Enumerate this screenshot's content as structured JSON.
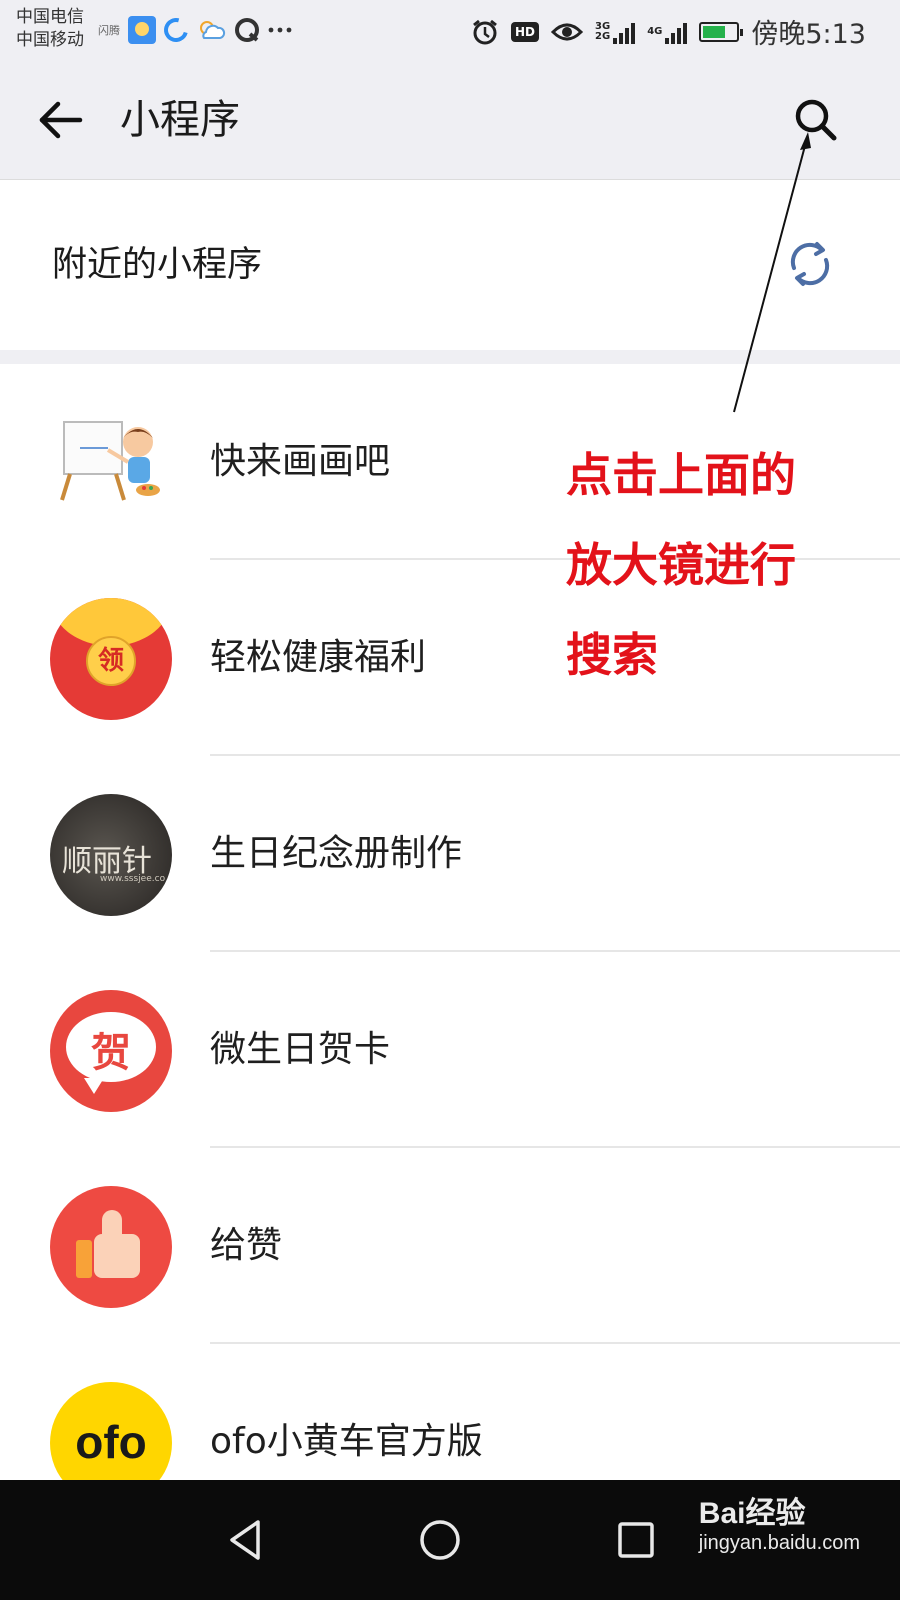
{
  "status_bar": {
    "carrier_1": "中国电信",
    "carrier_2": "中国移动",
    "small_label": "闪腾",
    "network_1": "3G",
    "network_2": "2G",
    "network_3": "4G",
    "hd": "HD",
    "time": "傍晚5:13",
    "battery_level": 0.6
  },
  "header": {
    "title": "小程序",
    "back_icon": "arrow-left-icon",
    "search_icon": "search-icon"
  },
  "nearby": {
    "label": "附近的小程序",
    "refresh_icon": "refresh-icon"
  },
  "apps": [
    {
      "name": "快来画画吧",
      "icon": "painting-icon"
    },
    {
      "name": "轻松健康福利",
      "icon": "red-envelope-icon",
      "badge": "领"
    },
    {
      "name": "生日纪念册制作",
      "icon": "album-icon",
      "icon_text": "顺丽针",
      "icon_sub": "www.sssjee.co"
    },
    {
      "name": "微生日贺卡",
      "icon": "greeting-card-icon",
      "icon_text": "贺"
    },
    {
      "name": "给赞",
      "icon": "thumbs-up-icon"
    },
    {
      "name": "ofo小黄车官方版",
      "icon": "ofo-icon",
      "icon_text": "ofo"
    }
  ],
  "annotation": {
    "line_1": "点击上面的",
    "line_2": "放大镜进行",
    "line_3": "搜索",
    "color": "#e3121a"
  },
  "watermark": {
    "logo": "Bai经验",
    "url": "jingyan.baidu.com"
  }
}
